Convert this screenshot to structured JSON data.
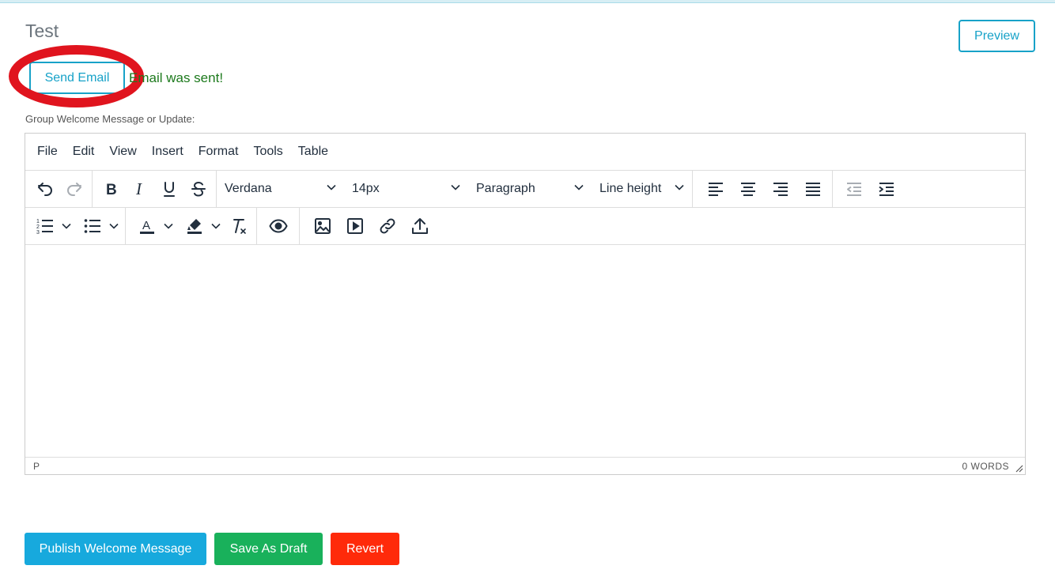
{
  "page": {
    "title": "Test",
    "preview_label": "Preview",
    "send_email_label": "Send Email",
    "status_message": "Email was sent!",
    "field_label": "Group Welcome Message or Update:"
  },
  "editor": {
    "menu": [
      "File",
      "Edit",
      "View",
      "Insert",
      "Format",
      "Tools",
      "Table"
    ],
    "font_family": "Verdana",
    "font_size": "14px",
    "block_format": "Paragraph",
    "line_height": "Line height",
    "statusbar_path": "P",
    "word_count": "0 WORDS",
    "icons_toolbar1": [
      "undo-icon",
      "redo-icon",
      "bold-icon",
      "italic-icon",
      "underline-icon",
      "strikethrough-icon",
      "align-left-icon",
      "align-center-icon",
      "align-right-icon",
      "align-justify-icon",
      "outdent-icon",
      "indent-icon"
    ],
    "icons_toolbar2": [
      "numbered-list-icon",
      "bullet-list-icon",
      "text-color-icon",
      "highlight-color-icon",
      "clear-formatting-icon",
      "preview-eye-icon",
      "image-icon",
      "media-icon",
      "link-icon",
      "upload-icon"
    ]
  },
  "actions": {
    "publish_label": "Publish Welcome Message",
    "draft_label": "Save As Draft",
    "revert_label": "Revert"
  },
  "colors": {
    "accent": "#17a2c8",
    "success_text": "#1d7a1d",
    "highlight_ring": "#e0141e",
    "publish": "#17a9dd",
    "draft": "#19b15b",
    "revert": "#ff2a0a"
  }
}
